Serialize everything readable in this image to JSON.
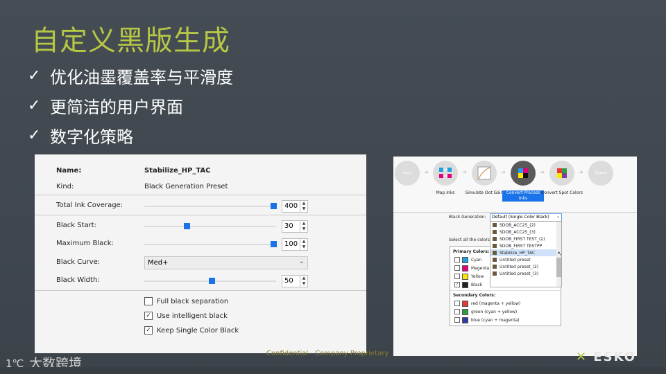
{
  "slide": {
    "title": "自定义黑版生成",
    "bullets": [
      "优化油墨覆盖率与平滑度",
      "更简洁的用户界面",
      "数字化策略"
    ],
    "check_glyph": "✓",
    "footer_confidential": "Confidential - Company Proprietary",
    "watermark_text": "大数跨境",
    "brand_logo": "ESKO",
    "colors": {
      "title": "#b5c745",
      "background": "#454c54",
      "accent_blue": "#1a73e8"
    }
  },
  "left_panel": {
    "name_label": "Name:",
    "name_value": "Stabilize_HP_TAC",
    "kind_label": "Kind:",
    "kind_value": "Black Generation Preset",
    "tic_label": "Total Ink Coverage:",
    "tic_value": "400",
    "tic_fraction": 0.98,
    "black_start_label": "Black Start:",
    "black_start_value": "30",
    "black_start_fraction": 0.32,
    "max_black_label": "Maximum Black:",
    "max_black_value": "100",
    "max_black_fraction": 0.98,
    "curve_label": "Black Curve:",
    "curve_value": "Med+",
    "width_label": "Black Width:",
    "width_value": "50",
    "width_fraction": 0.51,
    "checkboxes": [
      {
        "label": "Full black separation",
        "checked": false
      },
      {
        "label": "Use intelligent black",
        "checked": true
      },
      {
        "label": "Keep Single Color Black",
        "checked": true
      }
    ]
  },
  "right_panel": {
    "steps": [
      {
        "label": "Input",
        "inside": true
      },
      {
        "label": "Map Inks",
        "inside": false
      },
      {
        "label": "Simulate Dot Gain",
        "inside": false
      },
      {
        "label": "Convert Process Inks",
        "inside": false,
        "active": true
      },
      {
        "label": "Convert Spot Colors",
        "inside": false
      },
      {
        "label": "Output",
        "inside": true
      }
    ],
    "bg_label": "Black Generation:",
    "bg_selected": "Default (Single Color Black)",
    "select_all_label": "Select all the colors yo",
    "dropdown_items": [
      "SDOB_ACC25_(2)",
      "SDOB_ACC25_(3)",
      "SDOB_FIRST TEST_(2)",
      "SDOB_FIRST TESTPP",
      "Stabilize_HP_TAC",
      "Untitled preset",
      "Untitled preset_(2)",
      "Untitled preset_(3)"
    ],
    "dropdown_selected_index": 4,
    "primary_header": "Primary Colors:",
    "primary": [
      {
        "label": "Cyan",
        "color": "#1ba1e2",
        "checked": false
      },
      {
        "label": "Magenta",
        "color": "#e4007c",
        "checked": false
      },
      {
        "label": "Yellow",
        "color": "#ffe600",
        "checked": false
      },
      {
        "label": "Black",
        "color": "#222222",
        "checked": true
      }
    ],
    "secondary_header": "Secondary Colors:",
    "secondary": [
      {
        "label": "red (magenta + yellow)",
        "color": "#e53935"
      },
      {
        "label": "green (cyan + yellow)",
        "color": "#2e9e44"
      },
      {
        "label": "blue (cyan + magenta)",
        "color": "#2a3aa8"
      }
    ]
  }
}
